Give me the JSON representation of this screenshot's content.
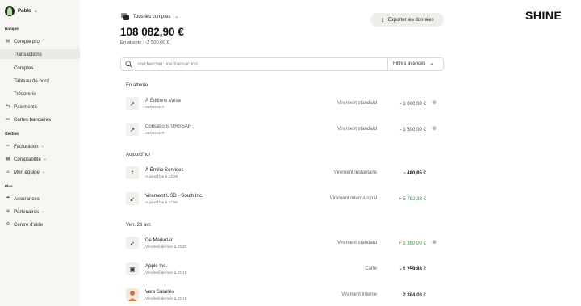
{
  "sidebar": {
    "brand": {
      "name": "Pablo"
    },
    "sections": {
      "banque": "Banque",
      "gestion": "Gestion",
      "plus": "Plus"
    },
    "compte_pro": "Compte pro",
    "sub": {
      "transactions": "Transactions",
      "comptes": "Comptes",
      "tableau": "Tableau de bord",
      "tresorerie": "Trésorerie"
    },
    "paiements": "Paiements",
    "cartes": "Cartes bancaires",
    "facturation": "Facturation",
    "comptabilite": "Comptabilité",
    "equipe": "Mon équipe",
    "assurances": "Assurances",
    "partenaires": "Partenaires",
    "aide": "Centre d'aide"
  },
  "logo": "SHINE",
  "header": {
    "account_select": "Tous les comptes",
    "balance": "108 082,90 €",
    "pending": "En attente : -2 500,00 €",
    "export_label": "Exporter les données"
  },
  "search": {
    "placeholder": "Rechercher une transaction",
    "filters_label": "Filtres avancés"
  },
  "groups": {
    "en_attente": "En attente",
    "aujourdhui": "Aujourd'hui",
    "ven26": "Ven. 26 avr."
  },
  "transactions": [
    {
      "name": "À Éditions Valsa",
      "date": "28/04/2024",
      "type": "Virement standard",
      "amount": "- 1 000,00 €"
    },
    {
      "name": "Cotisations URSSAF",
      "date": "28/04/2024",
      "type": "Virement standard",
      "amount": "- 1 500,00 €"
    },
    {
      "name": "À Émilie Services",
      "date": "Aujourd'hui à 14:25",
      "type": "Virement instantané",
      "amount": "- 480,85 €"
    },
    {
      "name": "Virement USD - South Inc.",
      "date": "Aujourd'hui à 11:20",
      "type": "Virement international",
      "amount": "+ 5 782,38 €"
    },
    {
      "name": "De Market-in",
      "date": "Vendredi dernier à 15:20",
      "type": "Virement standard",
      "amount": "+ 1 380,00 €"
    },
    {
      "name": "Apple Inc.",
      "date": "Vendredi dernier à 15:19",
      "type": "Carte",
      "amount": "- 1 259,88 €"
    },
    {
      "name": "Vers Salaires",
      "date": "Vendredi dernier à 15:18",
      "type": "Virement interne",
      "amount": "2 384,00 €"
    }
  ],
  "colors": {
    "sidebar_bg": "#f6f6f3",
    "active_item_bg": "#e9e9e5",
    "positive_amount": "#3f8f4a"
  }
}
